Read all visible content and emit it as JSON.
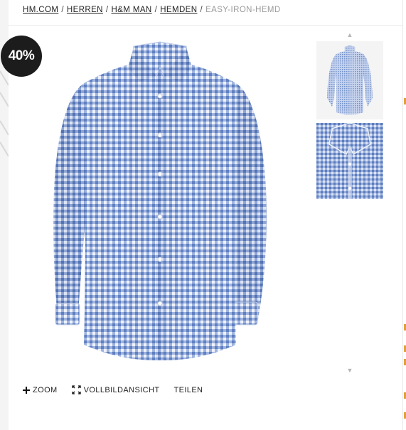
{
  "breadcrumb": {
    "items": [
      "HM.COM",
      "H&M MAN",
      "HEMDEN"
    ],
    "herren": "HERREN",
    "current": "EASY-IRON-HEMD",
    "separator": "/"
  },
  "badge": {
    "discount": "40%"
  },
  "tools": {
    "zoom": "ZOOM",
    "fullscreen": "VOLLBILDANSICHT",
    "share": "TEILEN"
  },
  "icons": {
    "zoom": "plus-icon",
    "fullscreen": "expand-icon",
    "up": "chevron-up-icon",
    "down": "chevron-down-icon"
  },
  "colors": {
    "badge_bg": "#1c1c1c",
    "shirt_blue": "#6f8fc9",
    "muted_text": "#9a9a9a",
    "accent": "#e0a040"
  }
}
